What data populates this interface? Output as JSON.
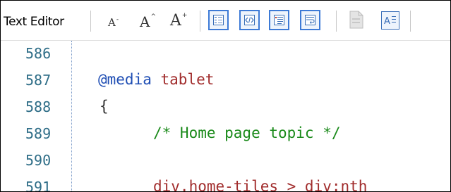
{
  "toolbar": {
    "title": "Text Editor",
    "font_small": "A",
    "font_mid": "A",
    "font_big": "A",
    "icons": [
      "font-decrease-icon",
      "font-reset-icon",
      "font-increase-icon",
      "line-numbers-icon",
      "code-icon",
      "word-wrap-icon",
      "wrap-text-icon",
      "document-icon",
      "text-format-icon"
    ]
  },
  "editor": {
    "line_numbers": [
      "586",
      "587",
      "588",
      "589",
      "590",
      "591"
    ],
    "lines": [
      {
        "text": ""
      },
      {
        "keyword": "@media",
        "rest": " tablet"
      },
      {
        "text": "{"
      },
      {
        "comment": "/* Home page topic */"
      },
      {
        "text": ""
      },
      {
        "selector": "div.home-tiles > div:nth"
      }
    ]
  }
}
